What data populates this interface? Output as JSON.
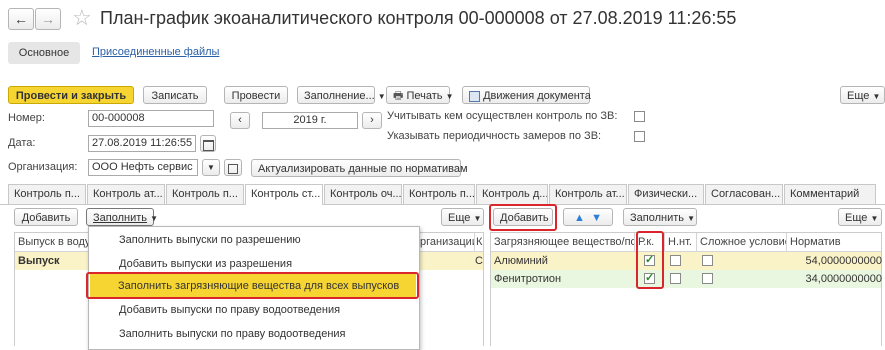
{
  "nav": {
    "back": "←",
    "forward": "→",
    "star": "☆"
  },
  "title": "План-график экоаналитического контроля 00-000008 от 27.08.2019 11:26:55",
  "section_tabs": [
    "Основное",
    "Присоединенные файлы"
  ],
  "toolbar": {
    "post_close": "Провести и закрыть",
    "save": "Записать",
    "post": "Провести",
    "fill": "Заполнение...",
    "print": "Печать",
    "movements": "Движения документа",
    "more": "Еще"
  },
  "form": {
    "number_label": "Номер:",
    "number_value": "00-000008",
    "date_label": "Дата:",
    "date_value": "27.08.2019 11:26:55",
    "org_label": "Организация:",
    "org_value": "ООО Нефть сервис",
    "year_value": "2019 г.",
    "zv_label": "Учитывать кем осуществлен контроль по ЗВ:",
    "period_label": "Указывать периодичность замеров по ЗВ:",
    "actualize_btn": "Актуализировать данные по нормативам"
  },
  "tabs": [
    "Контроль п...",
    "Контроль ат...",
    "Контроль п...",
    "Контроль ст...",
    "Контроль оч...",
    "Контроль п...",
    "Контроль д...",
    "Контроль ат...",
    "Физически...",
    "Согласован...",
    "Комментарий"
  ],
  "left_panel": {
    "add": "Добавить",
    "fill": "Заполнить",
    "more": "Еще",
    "col_outlet": "Выпуск в воду",
    "col_org": "рганизации",
    "col_k": "К",
    "row_outlet": "Выпуск",
    "row_k": "С"
  },
  "menu": [
    "Заполнить выпуски по разрешению",
    "Добавить выпуски из разрешения",
    "Заполнить загрязняющие вещества для всех выпусков",
    "Добавить выпуски по праву водоотведения",
    "Заполнить выпуски по праву водоотведения"
  ],
  "right_panel": {
    "add": "Добавить",
    "up": "▲",
    "down": "▼",
    "fill": "Заполнить",
    "more": "Еще",
    "columns": [
      "Загрязняющее вещество/по...",
      "Р.к.",
      "Н.нт.",
      "Сложное условие",
      "Норматив"
    ],
    "rows": [
      {
        "substance": "Алюминий",
        "rk": true,
        "nnt": false,
        "complex": false,
        "norm": "54,0000000000"
      },
      {
        "substance": "Фенитротион",
        "rk": true,
        "nnt": false,
        "complex": false,
        "norm": "34,0000000000"
      }
    ]
  },
  "colors": {
    "primary_btn": "#f6d533",
    "highlight_red": "#d9262c",
    "row_selected": "#fbf3c8",
    "row_green": "#eaf7e0"
  }
}
